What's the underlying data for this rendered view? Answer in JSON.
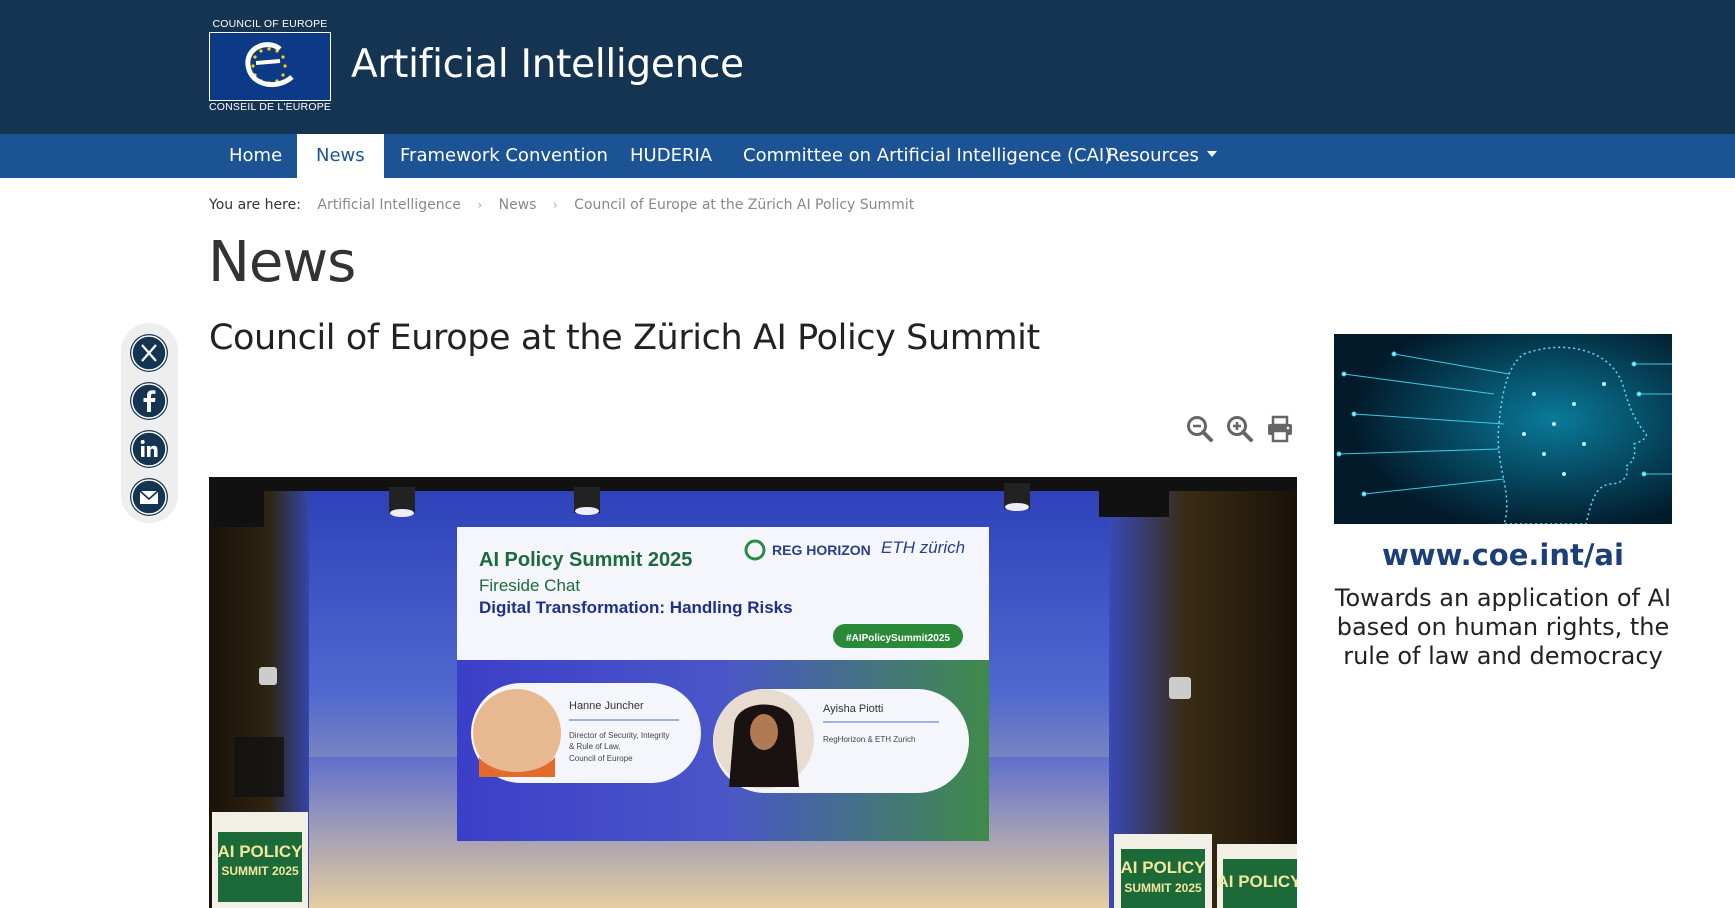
{
  "header": {
    "logo_top": "COUNCIL OF EUROPE",
    "logo_bottom": "CONSEIL DE L'EUROPE",
    "site_title": "Artificial Intelligence",
    "bg_color": "#153452"
  },
  "nav": {
    "items": [
      {
        "label": "Home"
      },
      {
        "label": "News",
        "active": true
      },
      {
        "label": "Framework Convention"
      },
      {
        "label": "HUDERIA"
      },
      {
        "label": "Committee on Artificial Intelligence (CAI)"
      },
      {
        "label": "Resources",
        "has_dropdown": true
      }
    ],
    "bg_color": "#1c5394"
  },
  "breadcrumb": {
    "lead": "You are here:",
    "items": [
      "Artificial Intelligence",
      "News",
      "Council of Europe at the Zürich AI Policy Summit"
    ]
  },
  "page_title": "News",
  "article": {
    "title": "Council of Europe at the Zürich AI Policy Summit"
  },
  "share": {
    "icons": [
      "x-icon",
      "facebook-icon",
      "linkedin-icon",
      "email-icon"
    ]
  },
  "tools": {
    "icons": [
      "zoom-out-icon",
      "zoom-in-icon",
      "print-icon"
    ]
  },
  "hero_image": {
    "screen": {
      "summit_title": "AI Policy Summit 2025",
      "subtitle": "Fireside Chat",
      "topic": "Digital Transformation: Handling Risks",
      "brand1": "REG HORIZON",
      "brand2": "ETH zürich",
      "hashtag": "#AIPolicySummit2025",
      "speaker1_name": "Hanne Juncher",
      "speaker1_role_line1": "Director of Security, Integrity",
      "speaker1_role_line2": "& Rule of Law,",
      "speaker1_role_line3": "Council of Europe",
      "speaker2_name": "Ayisha Piotti",
      "speaker2_role": "RegHorizon & ETH Zurich"
    },
    "banner_text_line1": "AI POLICY",
    "banner_text_line2": "SUMMIT 2025",
    "banner_right_line1": "AI POLICY",
    "banner_right_line2": "SUMMIT 2025",
    "banner_far_right": "AI POLICY"
  },
  "sidebar": {
    "link": "www.coe.int/ai",
    "text": "Towards an application of AI based on human rights, the rule of law and democracy"
  }
}
